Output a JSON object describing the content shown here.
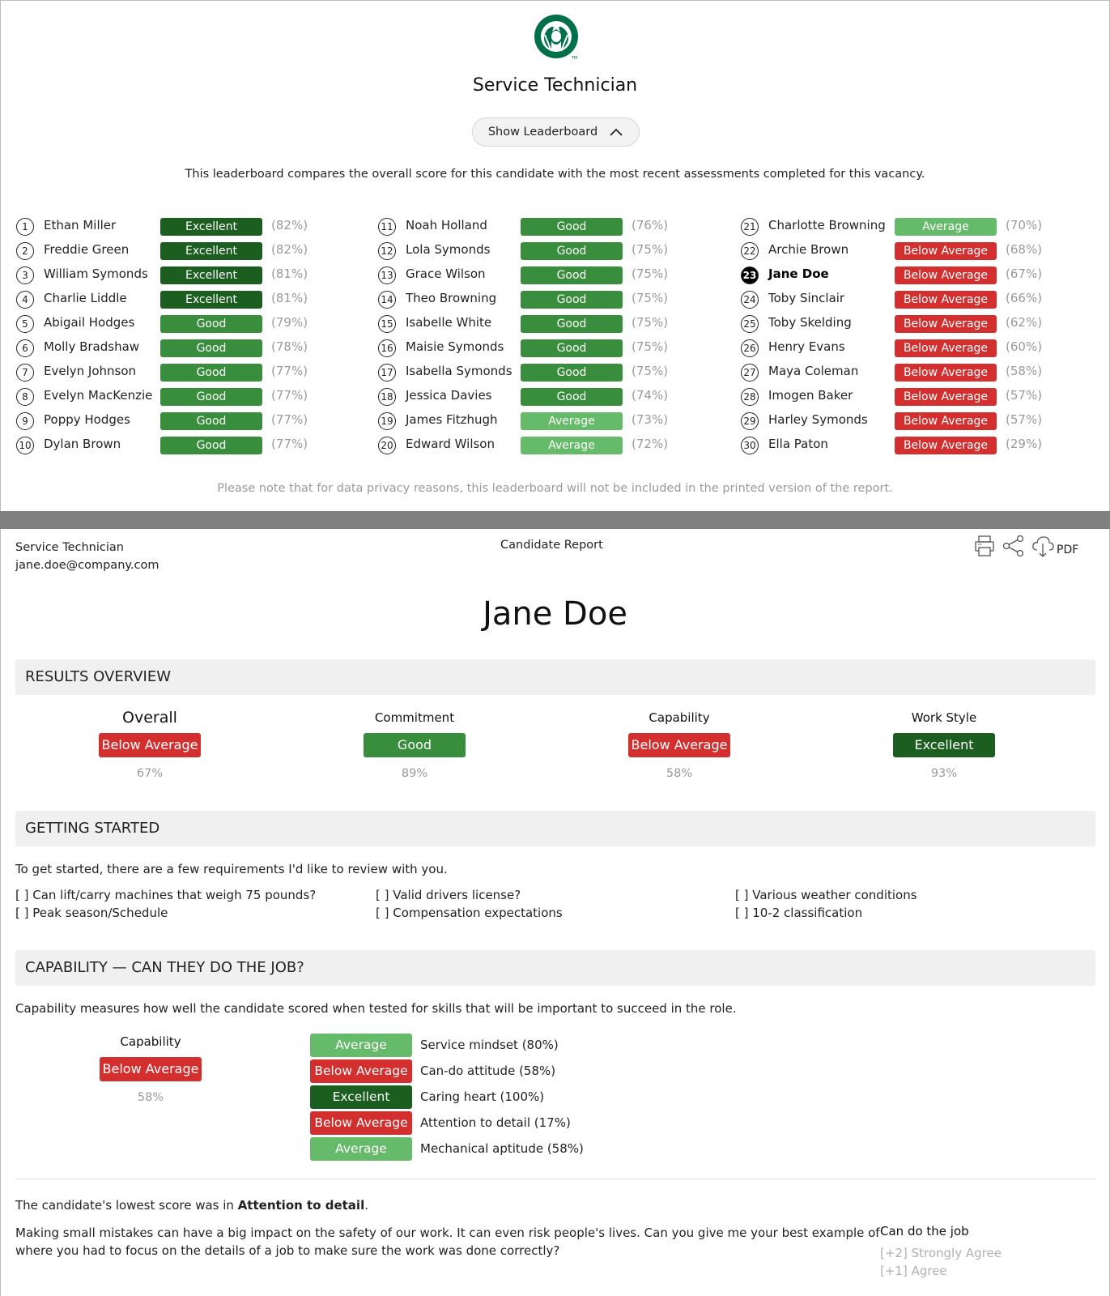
{
  "leaderboard_panel": {
    "logo": "starbucks-siren-logo",
    "job_title": "Service Technician",
    "toggle_label": "Show Leaderboard",
    "toggle_icon": "chevron-up-icon",
    "description": "This leaderboard compares the overall score for this candidate with the most recent assessments completed for this vacancy.",
    "entries": [
      {
        "rank": "1",
        "name": "Ethan Miller",
        "rating": "Excellent",
        "pct": "(82%)"
      },
      {
        "rank": "2",
        "name": "Freddie Green",
        "rating": "Excellent",
        "pct": "(82%)"
      },
      {
        "rank": "3",
        "name": "William Symonds",
        "rating": "Excellent",
        "pct": "(81%)"
      },
      {
        "rank": "4",
        "name": "Charlie Liddle",
        "rating": "Excellent",
        "pct": "(81%)"
      },
      {
        "rank": "5",
        "name": "Abigail Hodges",
        "rating": "Good",
        "pct": "(79%)"
      },
      {
        "rank": "6",
        "name": "Molly Bradshaw",
        "rating": "Good",
        "pct": "(78%)"
      },
      {
        "rank": "7",
        "name": "Evelyn Johnson",
        "rating": "Good",
        "pct": "(77%)"
      },
      {
        "rank": "8",
        "name": "Evelyn MacKenzie",
        "rating": "Good",
        "pct": "(77%)"
      },
      {
        "rank": "9",
        "name": "Poppy Hodges",
        "rating": "Good",
        "pct": "(77%)"
      },
      {
        "rank": "10",
        "name": "Dylan Brown",
        "rating": "Good",
        "pct": "(77%)"
      },
      {
        "rank": "11",
        "name": "Noah Holland",
        "rating": "Good",
        "pct": "(76%)"
      },
      {
        "rank": "12",
        "name": "Lola Symonds",
        "rating": "Good",
        "pct": "(75%)"
      },
      {
        "rank": "13",
        "name": "Grace Wilson",
        "rating": "Good",
        "pct": "(75%)"
      },
      {
        "rank": "14",
        "name": "Theo Browning",
        "rating": "Good",
        "pct": "(75%)"
      },
      {
        "rank": "15",
        "name": "Isabelle White",
        "rating": "Good",
        "pct": "(75%)"
      },
      {
        "rank": "16",
        "name": "Maisie Symonds",
        "rating": "Good",
        "pct": "(75%)"
      },
      {
        "rank": "17",
        "name": "Isabella Symonds",
        "rating": "Good",
        "pct": "(75%)"
      },
      {
        "rank": "18",
        "name": "Jessica Davies",
        "rating": "Good",
        "pct": "(74%)"
      },
      {
        "rank": "19",
        "name": "James Fitzhugh",
        "rating": "Average",
        "pct": "(73%)"
      },
      {
        "rank": "20",
        "name": "Edward Wilson",
        "rating": "Average",
        "pct": "(72%)"
      },
      {
        "rank": "21",
        "name": "Charlotte Browning",
        "rating": "Average",
        "pct": "(70%)"
      },
      {
        "rank": "22",
        "name": "Archie Brown",
        "rating": "Below Average",
        "pct": "(68%)"
      },
      {
        "rank": "23",
        "name": "Jane Doe",
        "rating": "Below Average",
        "pct": "(67%)",
        "current": true
      },
      {
        "rank": "24",
        "name": "Toby Sinclair",
        "rating": "Below Average",
        "pct": "(66%)"
      },
      {
        "rank": "25",
        "name": "Toby Skelding",
        "rating": "Below Average",
        "pct": "(62%)"
      },
      {
        "rank": "26",
        "name": "Henry Evans",
        "rating": "Below Average",
        "pct": "(60%)"
      },
      {
        "rank": "27",
        "name": "Maya Coleman",
        "rating": "Below Average",
        "pct": "(58%)"
      },
      {
        "rank": "28",
        "name": "Imogen Baker",
        "rating": "Below Average",
        "pct": "(57%)"
      },
      {
        "rank": "29",
        "name": "Harley Symonds",
        "rating": "Below Average",
        "pct": "(57%)"
      },
      {
        "rank": "30",
        "name": "Ella Paton",
        "rating": "Below Average",
        "pct": "(29%)"
      }
    ],
    "privacy_note": "Please note that for data privacy reasons, this leaderboard will not be included in the printed version of the report."
  },
  "rating_colors": {
    "Excellent": "#1b5e20",
    "Good": "#388e3c",
    "Average": "#66bb6a",
    "Below Average": "#d32f2f"
  },
  "report": {
    "header": {
      "job_title": "Service Technician",
      "email": "jane.doe@company.com",
      "report_type": "Candidate Report",
      "actions": {
        "print_icon": "printer-icon",
        "share_icon": "share-icon",
        "download_icon": "cloud-download-icon",
        "pdf_label": "PDF"
      }
    },
    "candidate_name": "Jane Doe",
    "results_overview": {
      "heading": "RESULTS OVERVIEW",
      "items": [
        {
          "title": "Overall",
          "rating": "Below Average",
          "pct": "67%"
        },
        {
          "title": "Commitment",
          "rating": "Good",
          "pct": "89%"
        },
        {
          "title": "Capability",
          "rating": "Below Average",
          "pct": "58%"
        },
        {
          "title": "Work Style",
          "rating": "Excellent",
          "pct": "93%"
        }
      ]
    },
    "getting_started": {
      "heading": "GETTING STARTED",
      "intro": "To get started, there are a few requirements I'd like to review with you.",
      "requirements": [
        "[ ] Can lift/carry machines that weigh 75 pounds?",
        "[ ] Peak season/Schedule",
        "[ ] Valid drivers license?",
        "[ ] Compensation expectations",
        "[ ] Various weather conditions",
        "[ ] 10-2 classification"
      ]
    },
    "capability": {
      "heading": "CAPABILITY — CAN THEY DO THE JOB?",
      "intro": "Capability measures how well the candidate scored when tested for skills that will be important to succeed in the role.",
      "summary": {
        "title": "Capability",
        "rating": "Below Average",
        "pct": "58%"
      },
      "skills": [
        {
          "rating": "Average",
          "label": "Service mindset (80%)"
        },
        {
          "rating": "Below Average",
          "label": "Can-do attitude (58%)"
        },
        {
          "rating": "Excellent",
          "label": "Caring heart (100%)"
        },
        {
          "rating": "Below Average",
          "label": "Attention to detail (17%)"
        },
        {
          "rating": "Average",
          "label": "Mechanical aptitude (58%)"
        }
      ],
      "lowest_prefix": "The candidate's lowest score was in ",
      "lowest_skill": "Attention to detail",
      "lowest_suffix": ".",
      "question_line1": "Making small mistakes can have a big impact on the safety of our work. It can even risk people's lives. Can you give me your best example of",
      "question_line2": "where you had to focus on the details of a job to make sure the work was done correctly?",
      "scale_title": "Can do the job",
      "scale_options": [
        "[+2] Strongly Agree",
        "[+1] Agree"
      ]
    }
  }
}
